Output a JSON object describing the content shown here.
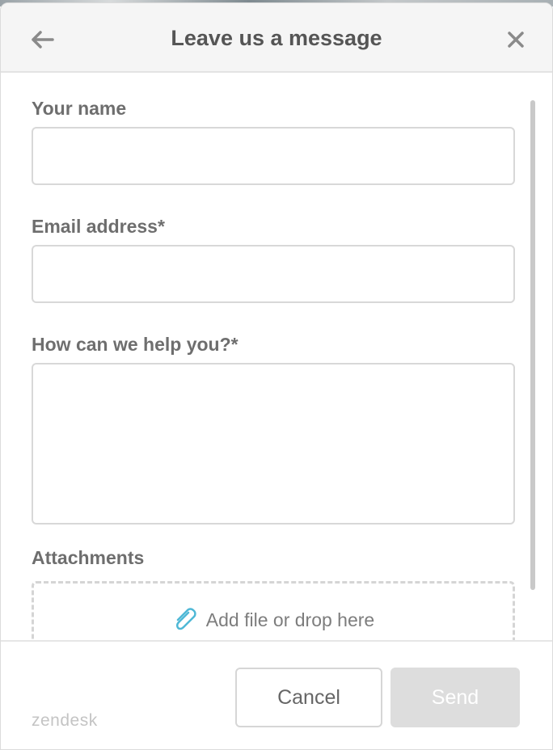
{
  "header": {
    "title": "Leave us a message",
    "back_icon": "arrow-left-icon",
    "close_icon": "close-icon"
  },
  "form": {
    "name": {
      "label": "Your name",
      "value": ""
    },
    "email": {
      "label": "Email address*",
      "value": ""
    },
    "message": {
      "label": "How can we help you?*",
      "value": ""
    },
    "attachments": {
      "label": "Attachments",
      "dropzone_text": "Add file or drop here",
      "icon": "paperclip-icon"
    }
  },
  "footer": {
    "brand": "zendesk",
    "cancel_label": "Cancel",
    "send_label": "Send"
  },
  "colors": {
    "accent_icon": "#4fb8d6",
    "send_disabled_bg": "#dddddd",
    "label_text": "#6e6e6e"
  }
}
